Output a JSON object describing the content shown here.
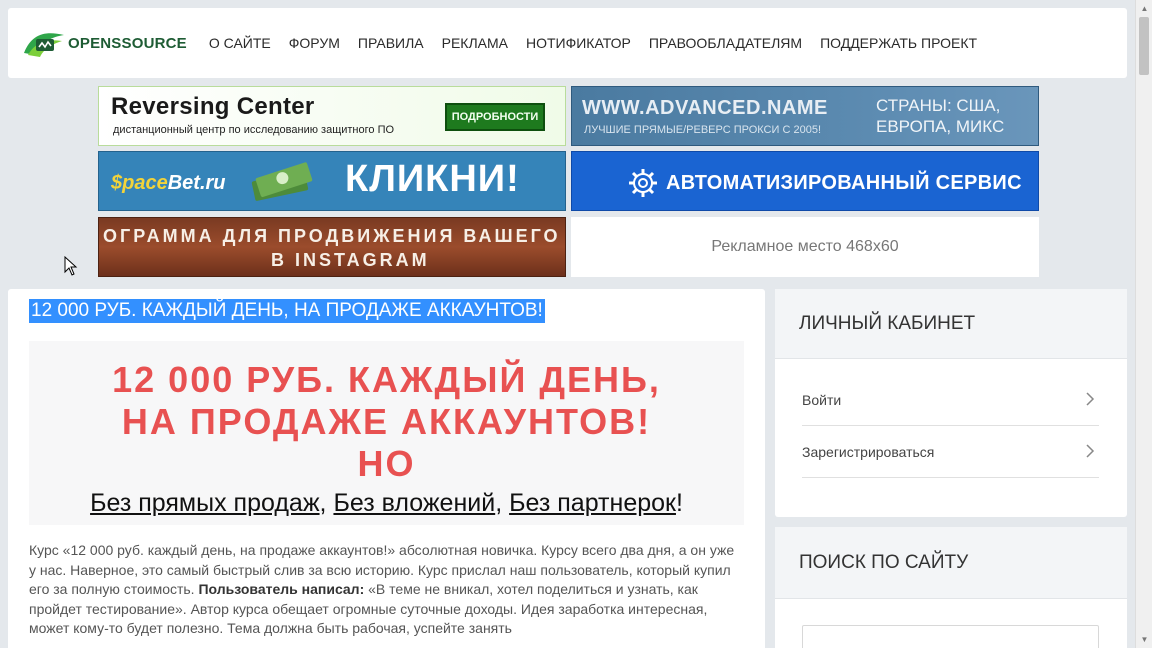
{
  "header": {
    "logo_text": "OPENSSOURCE",
    "nav": [
      "О САЙТЕ",
      "ФОРУМ",
      "ПРАВИЛА",
      "РЕКЛАМА",
      "НОТИФИКАТОР",
      "ПРАВООБЛАДАТЕЛЯМ",
      "ПОДДЕРЖАТЬ ПРОЕКТ"
    ]
  },
  "banners": {
    "reversing": {
      "title": "Reversing Center",
      "subtitle": "дистанционный центр по исследованию защитного ПО",
      "button": "ПОДРОБНОСТИ"
    },
    "advanced": {
      "title": "WWW.ADVANCED.NAME",
      "subtitle": "ЛУЧШИЕ ПРЯМЫЕ/РЕВЕРС ПРОКСИ С 2005!",
      "right_line1": "СТРАНЫ: США,",
      "right_line2": "ЕВРОПА, МИКС"
    },
    "spacebet": {
      "logo_a": "$pace",
      "logo_b": "Bet",
      "logo_c": ".ru",
      "cta": "КЛИКНИ!"
    },
    "auto": {
      "text": "АВТОМАТИЗИРОВАННЫЙ СЕРВИС"
    },
    "instagram": {
      "line1": "ОГРАММА ДЛЯ ПРОДВИЖЕНИЯ ВАШЕГО БИЗНЕ",
      "line2": "В INSTAGRAM"
    },
    "placeholder": {
      "text": "Рекламное место 468х60"
    }
  },
  "post": {
    "title": "12 000 РУБ. КАЖДЫЙ ДЕНЬ, НА ПРОДАЖЕ АККАУНТОВ!",
    "promo_line1": "12 000 РУБ. КАЖДЫЙ ДЕНЬ,",
    "promo_line2": "НА ПРОДАЖЕ АККАУНТОВ!",
    "promo_line3": "НО",
    "promo_sub_1": "Без прямых продаж",
    "promo_sub_sep1": ", ",
    "promo_sub_2": "Без вложений",
    "promo_sub_sep2": ", ",
    "promo_sub_3": "Без партнерок",
    "promo_sub_end": "!",
    "text_1": "Курс «12 000 руб. каждый день, на продаже аккаунтов!» абсолютная новичка. Курсу всего два дня, а он уже у нас. Наверное, это самый быстрый слив за всю историю. Курс прислал наш пользователь, который купил его за полную стоимость. ",
    "text_bold": "Пользователь написал:",
    "text_2": " «В теме не вникал, хотел поделиться и узнать, как пройдет тестирование». Автор курса обещает огромные суточные доходы. Идея заработка интересная, может кому-то будет полезно. Тема должна быть рабочая, успейте занять"
  },
  "sidebar": {
    "account_title": "ЛИЧНЫЙ КАБИНЕТ",
    "login": "Войти",
    "register": "Зарегистрироваться",
    "search_title": "ПОИСК ПО САЙТУ"
  },
  "colors": {
    "accent": "#3390ff",
    "promo_red": "#e85151",
    "logo_green": "#1e5c34"
  }
}
